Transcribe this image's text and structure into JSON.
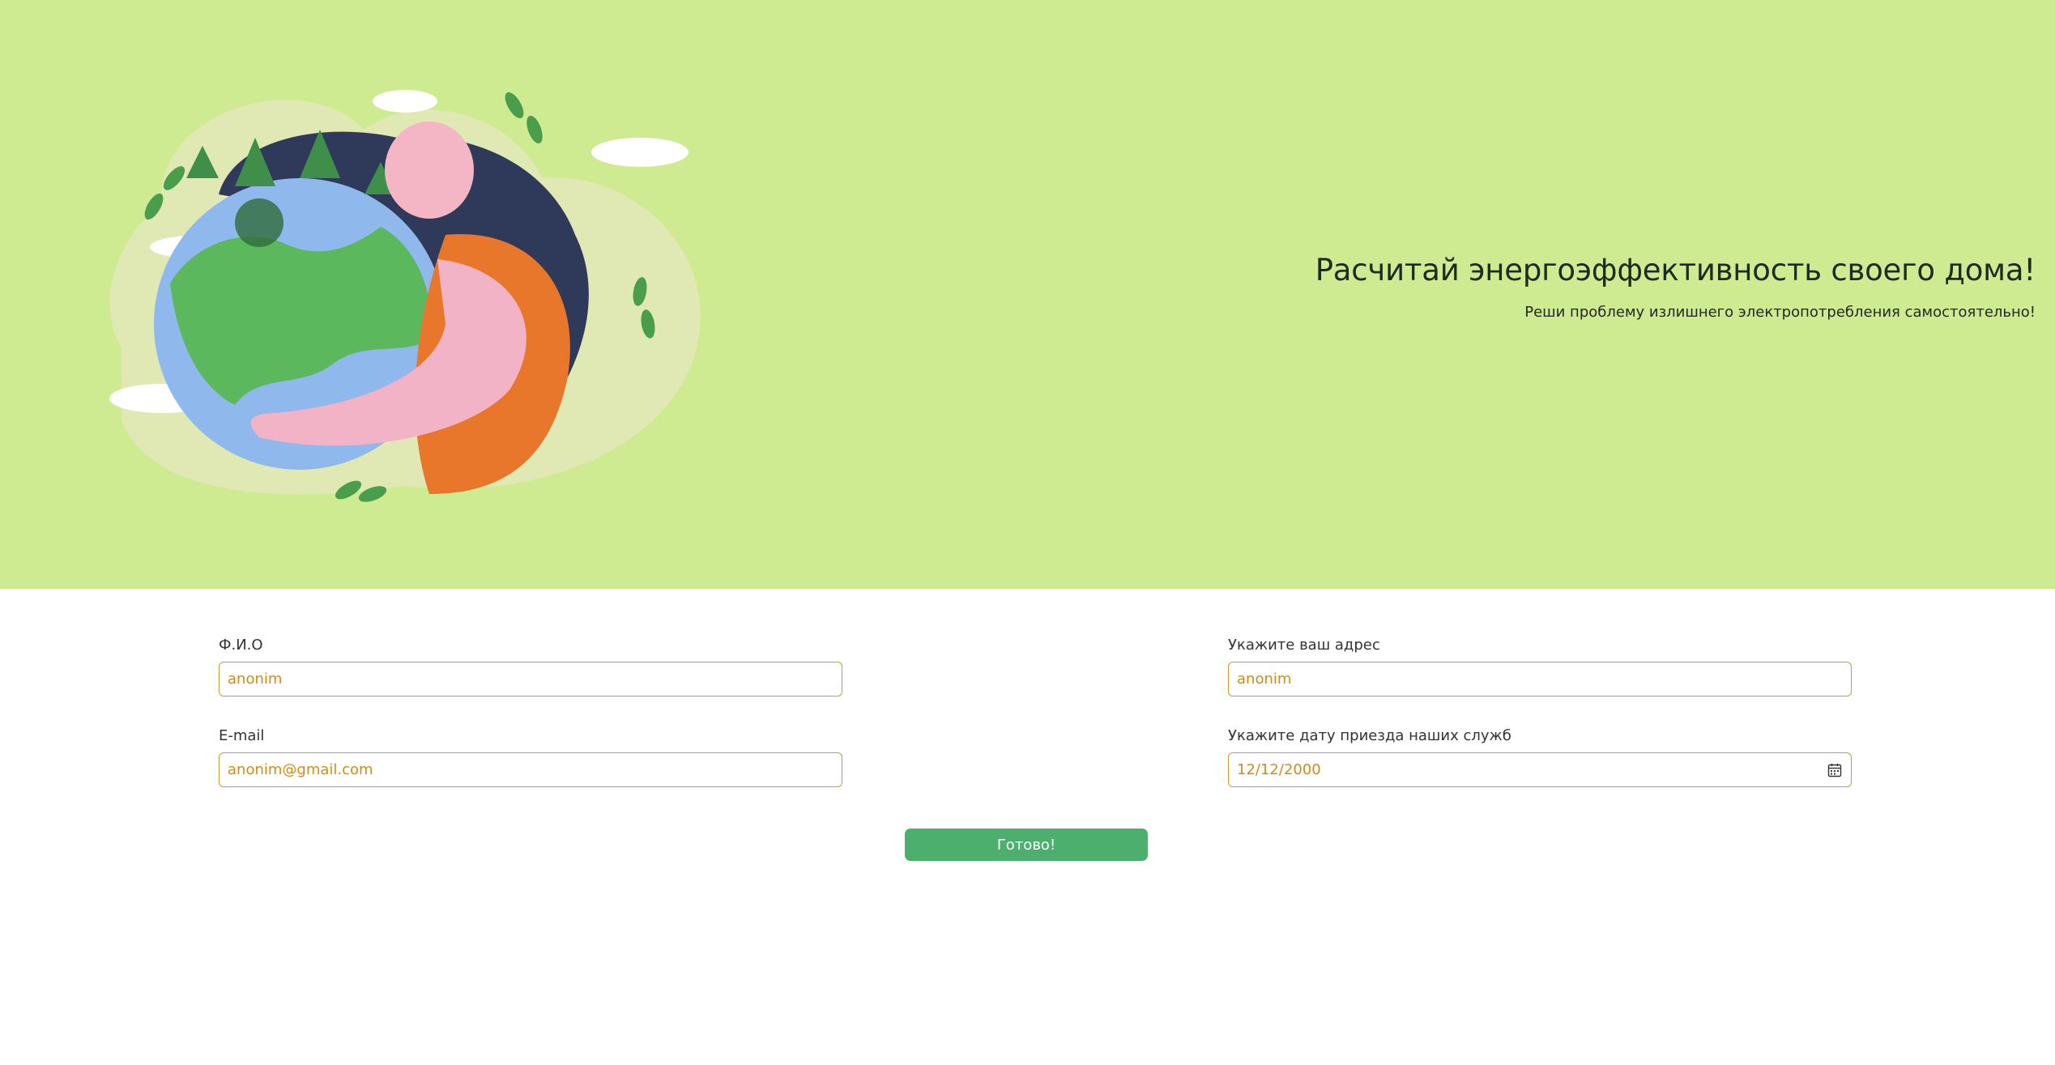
{
  "hero": {
    "title": "Расчитай энергоэффективность своего дома!",
    "subtitle": "Реши проблему излишнего электропотребления самостоятельно!",
    "background_color": "#cfeb91",
    "illustration": "woman-hugging-earth-illustration"
  },
  "form": {
    "fio": {
      "label": "Ф.И.О",
      "value": "anonim"
    },
    "email": {
      "label": "E-mail",
      "value": "anonim@gmail.com"
    },
    "address": {
      "label": "Укажите ваш адрес",
      "value": "anonim"
    },
    "date": {
      "label": "Укажите дату приезда наших служб",
      "value": "12/12/2000",
      "icon": "calendar-icon"
    },
    "submit_label": "Готово!",
    "accent_color": "#d59a2b",
    "button_color": "#4caf6e"
  }
}
